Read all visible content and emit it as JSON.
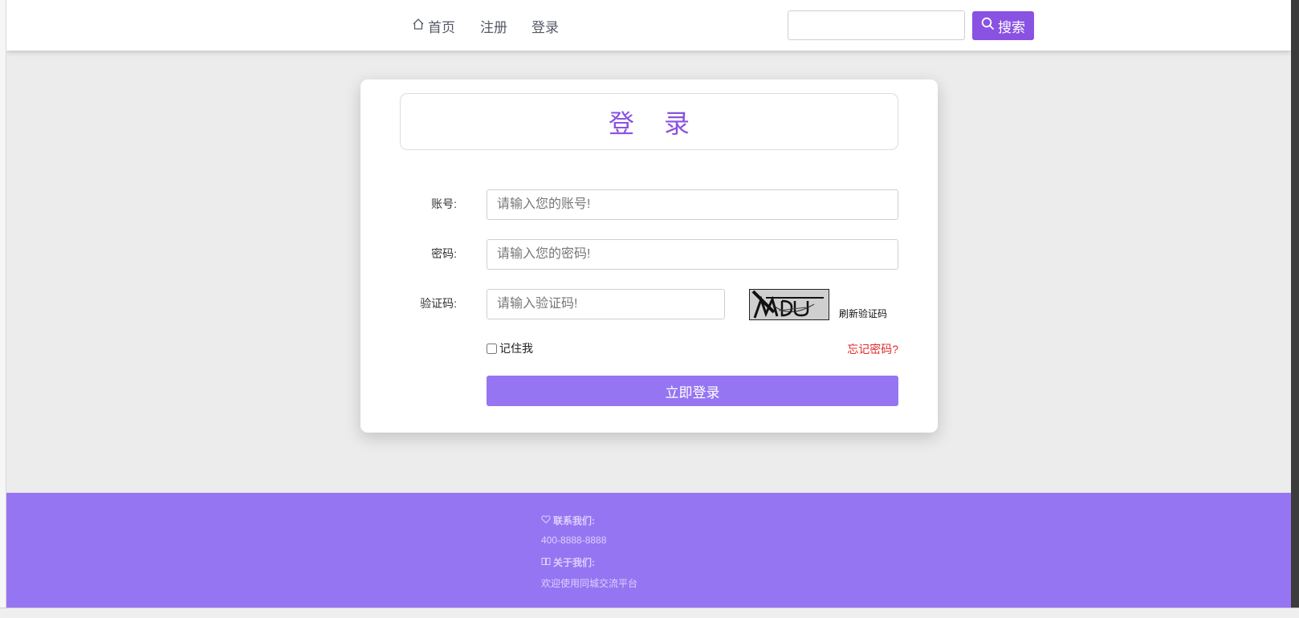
{
  "nav": {
    "items": [
      {
        "label": "首页",
        "icon": "home-icon"
      },
      {
        "label": "注册"
      },
      {
        "label": "登录"
      }
    ],
    "search": {
      "placeholder": "",
      "button_label": "搜索",
      "icon": "search-icon"
    }
  },
  "login_card": {
    "title": "登 录",
    "fields": {
      "account": {
        "label": "账号:",
        "placeholder": "请输入您的账号!"
      },
      "password": {
        "label": "密码:",
        "placeholder": "请输入您的密码!"
      },
      "code": {
        "label": "验证码:",
        "placeholder": "请输入验证码!"
      }
    },
    "captcha_text": "MDU",
    "refresh_label": "刷新验证码",
    "remember_label": "记住我",
    "remember_checked": false,
    "forgot_label": "忘记密码?",
    "submit_label": "立即登录"
  },
  "footer": {
    "contact_heading": "联系我们:",
    "contact_value": "400-8888-8888",
    "about_heading": "关于我们:",
    "about_value": "欢迎使用同城交流平台"
  },
  "colors": {
    "accent": "#8a52e3",
    "button": "#9575f2",
    "footer_bg": "#9675f2",
    "forgot_link": "#e02a2a",
    "page_bg": "#ececec"
  }
}
